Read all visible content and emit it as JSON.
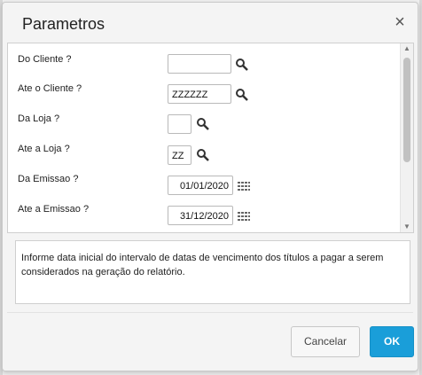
{
  "dialog": {
    "title": "Parametros",
    "close_symbol": "×"
  },
  "fields": [
    {
      "label": "Do Cliente ?",
      "value": "",
      "button": "search-icon"
    },
    {
      "label": "Ate o Cliente ?",
      "value": "ZZZZZZ",
      "button": "search-icon"
    },
    {
      "label": "Da Loja ?",
      "value": "",
      "button": "search-icon"
    },
    {
      "label": "Ate a Loja ?",
      "value": "ZZ",
      "button": "search-icon"
    },
    {
      "label": "Da Emissao ?",
      "value": "01/01/2020",
      "button": "calendar-icon"
    },
    {
      "label": "Ate a Emissao ?",
      "value": "31/12/2020",
      "button": "calendar-icon"
    }
  ],
  "help_text": "Informe data inicial do intervalo de datas de vencimento dos títulos a pagar a serem considerados na geração do relatório.",
  "buttons": {
    "cancel": "Cancelar",
    "ok": "OK"
  },
  "colors": {
    "primary": "#1a9ed9",
    "dialog_bg": "#f4f4f4"
  }
}
